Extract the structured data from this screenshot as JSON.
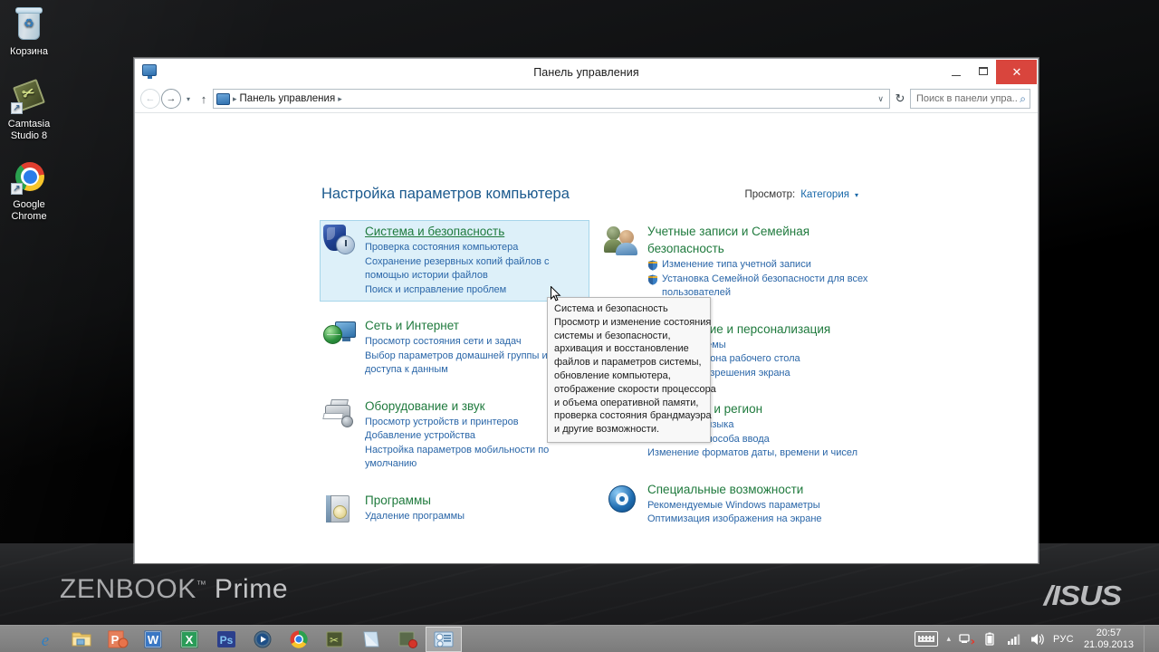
{
  "desktop": {
    "icons": [
      {
        "name": "recycle-bin",
        "label": "Корзина"
      },
      {
        "name": "camtasia",
        "label_line1": "Camtasia",
        "label_line2": "Studio 8"
      },
      {
        "name": "chrome",
        "label_line1": "Google",
        "label_line2": "Chrome"
      }
    ],
    "branding": {
      "zenbook": "ZENBOOK",
      "tm": "™",
      "prime": "Prime",
      "asus": "/ISUS"
    }
  },
  "window": {
    "title": "Панель управления",
    "buttons": {
      "minimize": "—",
      "maximize": "□",
      "close": "✕"
    },
    "address": {
      "back": "←",
      "forward": "→",
      "history_caret": "▾",
      "up": "↑",
      "crumb_root": "Панель управления",
      "sep": "▸",
      "dropdown": "∨",
      "refresh": "↻"
    },
    "search": {
      "placeholder": "Поиск в панели упра...",
      "icon": "search-icon"
    }
  },
  "main": {
    "heading": "Настройка параметров компьютера",
    "view_by": {
      "label": "Просмотр:",
      "value": "Категория",
      "caret": "▾"
    },
    "left_column": [
      {
        "name": "system-and-security",
        "title": "Система и безопасность",
        "hovered": true,
        "links": [
          "Проверка состояния компьютера",
          "Сохранение резервных копий файлов с",
          "помощью истории файлов",
          "Поиск и исправление проблем"
        ]
      },
      {
        "name": "network-and-internet",
        "title": "Сеть и Интернет",
        "hovered": false,
        "links": [
          "Просмотр состояния сети и задач",
          "Выбор параметров домашней группы и",
          "доступа к данным"
        ]
      },
      {
        "name": "hardware-and-sound",
        "title": "Оборудование и звук",
        "hovered": false,
        "links": [
          "Просмотр устройств и принтеров",
          "Добавление устройства",
          "Настройка параметров мобильности по",
          "умолчанию"
        ]
      },
      {
        "name": "programs",
        "title": "Программы",
        "hovered": false,
        "links": [
          "Удаление программы"
        ]
      }
    ],
    "right_column": [
      {
        "name": "user-accounts-and-family-safety",
        "title": "Учетные записи и Семейная",
        "title2": "безопасность",
        "links": [
          {
            "text": "Изменение типа учетной записи",
            "shield": true
          },
          {
            "text": "Установка Семейной безопасности для всех",
            "shield": true
          },
          {
            "text": "пользователей",
            "shield": false,
            "indent": true
          }
        ]
      },
      {
        "name": "appearance-and-personalization",
        "title": "Оформление и персонализация",
        "links": [
          {
            "text": "Изменение темы",
            "shield": false
          },
          {
            "text": "Изменение фона рабочего стола",
            "shield": false
          },
          {
            "text": "Настройка разрешения экрана",
            "shield": false
          }
        ]
      },
      {
        "name": "clock-language-and-region",
        "title": "Часы, язык и регион",
        "links": [
          {
            "text": "Добавление языка",
            "shield": false
          },
          {
            "text": "Изменение способа ввода",
            "shield": false
          },
          {
            "text": "Изменение форматов даты, времени и чисел",
            "shield": false
          }
        ]
      },
      {
        "name": "ease-of-access",
        "title": "Специальные возможности",
        "links": [
          {
            "text": "Рекомендуемые Windows параметры",
            "shield": false
          },
          {
            "text": "Оптимизация изображения на экране",
            "shield": false
          }
        ]
      }
    ],
    "tooltip": {
      "lines": [
        "Система и безопасность",
        "Просмотр и изменение состояния",
        "системы и безопасности,",
        "архивация и восстановление",
        "файлов и параметров системы,",
        "обновление компьютера,",
        "отображение скорости процессора",
        "и объема оперативной памяти,",
        "проверка состояния брандмауэра",
        "и другие возможности."
      ]
    }
  },
  "taskbar": {
    "apps": [
      {
        "name": "internet-explorer",
        "active": false
      },
      {
        "name": "file-explorer",
        "active": false
      },
      {
        "name": "powerpoint",
        "active": false
      },
      {
        "name": "word",
        "active": false
      },
      {
        "name": "excel",
        "active": false
      },
      {
        "name": "photoshop",
        "active": false
      },
      {
        "name": "media-player",
        "active": false
      },
      {
        "name": "chrome",
        "active": false
      },
      {
        "name": "camtasia",
        "active": false
      },
      {
        "name": "notepad",
        "active": false
      },
      {
        "name": "app-dark",
        "active": false
      },
      {
        "name": "control-panel",
        "active": true
      }
    ],
    "tray": {
      "keyboard": "keyboard-icon",
      "show_hidden": "▴",
      "network_error": "network-error-icon",
      "battery": "battery-icon",
      "signal": "signal-icon",
      "volume": "volume-icon",
      "language": "РУС",
      "time": "20:57",
      "date": "21.09.2013"
    }
  },
  "colors": {
    "accent_blue": "#1767a8",
    "link_blue": "#2a66a8",
    "heading_blue": "#1b5a8e",
    "category_green": "#1f7a3d",
    "close_red": "#d9453d",
    "hover_bg": "#ddf0f9"
  }
}
